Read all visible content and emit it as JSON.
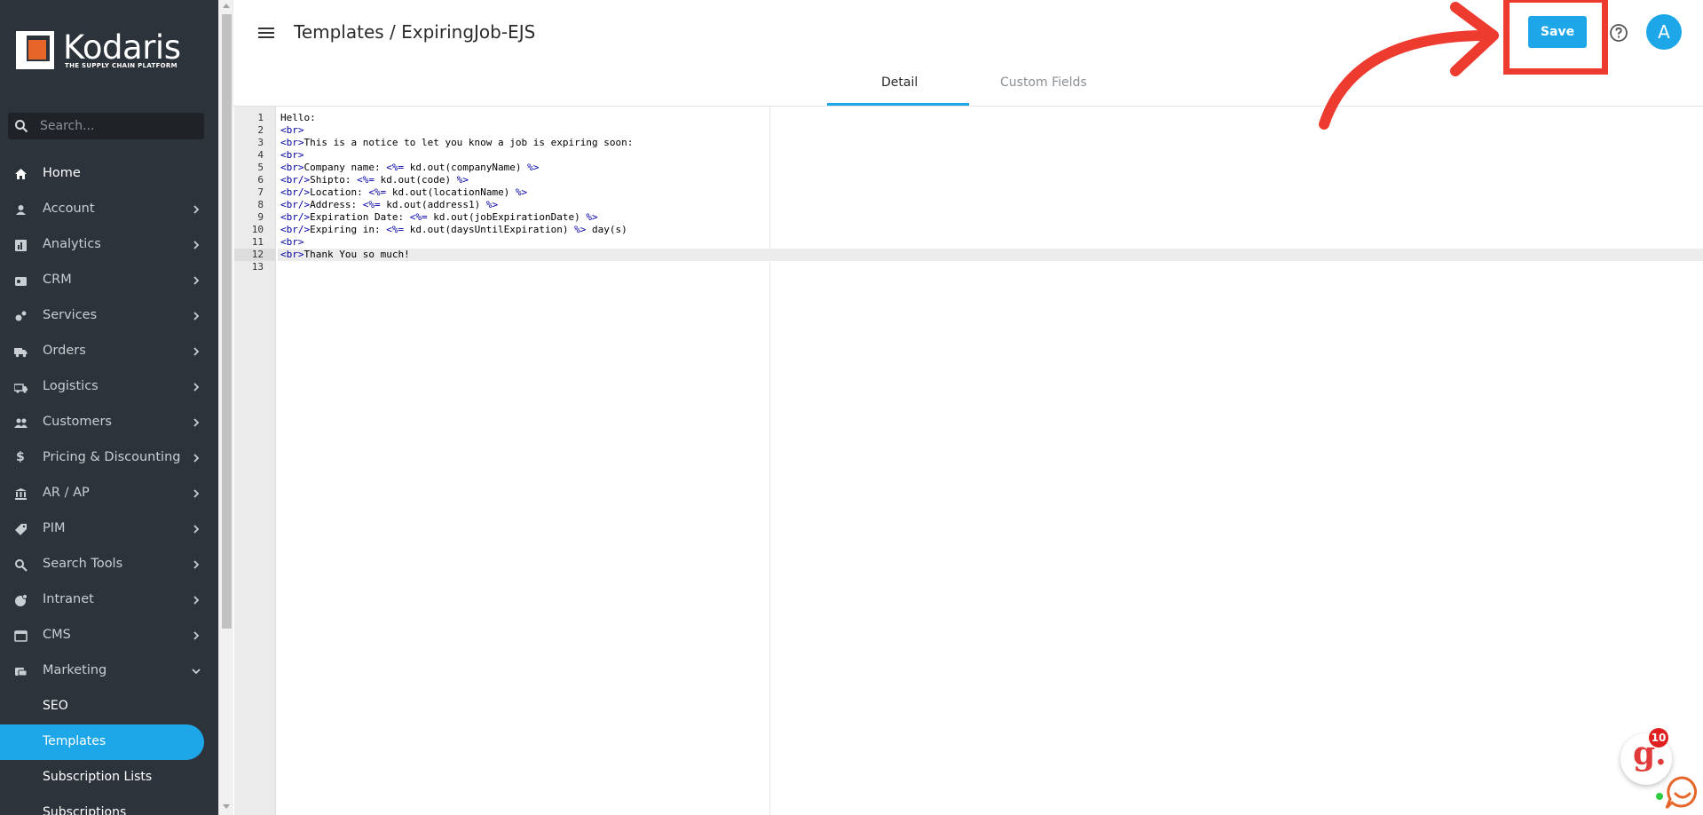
{
  "brand": {
    "name": "Kodaris",
    "tagline": "THE SUPPLY CHAIN PLATFORM",
    "logo_color": "#e8652a"
  },
  "search": {
    "placeholder": "Search..."
  },
  "sidebar": {
    "items": [
      {
        "label": "Home",
        "icon": "home-icon",
        "has_chevron": false
      },
      {
        "label": "Account",
        "icon": "account-icon",
        "has_chevron": true
      },
      {
        "label": "Analytics",
        "icon": "analytics-icon",
        "has_chevron": true
      },
      {
        "label": "CRM",
        "icon": "crm-icon",
        "has_chevron": true
      },
      {
        "label": "Services",
        "icon": "services-icon",
        "has_chevron": true
      },
      {
        "label": "Orders",
        "icon": "truck-icon",
        "has_chevron": true
      },
      {
        "label": "Logistics",
        "icon": "logistics-icon",
        "has_chevron": true
      },
      {
        "label": "Customers",
        "icon": "customers-icon",
        "has_chevron": true
      },
      {
        "label": "Pricing & Discounting",
        "icon": "dollar-icon",
        "has_chevron": true
      },
      {
        "label": "AR / AP",
        "icon": "bank-icon",
        "has_chevron": true
      },
      {
        "label": "PIM",
        "icon": "tag-icon",
        "has_chevron": true
      },
      {
        "label": "Search Tools",
        "icon": "search-tools-icon",
        "has_chevron": true
      },
      {
        "label": "Intranet",
        "icon": "intranet-icon",
        "has_chevron": true
      },
      {
        "label": "CMS",
        "icon": "cms-icon",
        "has_chevron": true
      },
      {
        "label": "Marketing",
        "icon": "marketing-icon",
        "has_chevron": true,
        "expanded": true
      }
    ],
    "sub_items": [
      {
        "label": "SEO",
        "active": false
      },
      {
        "label": "Templates",
        "active": true
      },
      {
        "label": "Subscription Lists",
        "active": false
      },
      {
        "label": "Subscriptions",
        "active": false
      }
    ]
  },
  "header": {
    "title": "Templates / ExpiringJob-EJS",
    "save_label": "Save",
    "avatar_initial": "A",
    "tabs": [
      {
        "label": "Detail",
        "active": true
      },
      {
        "label": "Custom Fields",
        "active": false
      }
    ]
  },
  "editor": {
    "active_line": 12,
    "lines": [
      "Hello:",
      "<br>",
      "<br>This is a notice to let you know a job is expiring soon:",
      "<br>",
      "<br>Company name: <%= kd.out(companyName) %>",
      "<br/>Shipto: <%= kd.out(code) %>",
      "<br/>Location: <%= kd.out(locationName) %>",
      "<br/>Address: <%= kd.out(address1) %>",
      "<br/>Expiration Date: <%= kd.out(jobExpirationDate) %>",
      "<br/>Expiring in: <%= kd.out(daysUntilExpiration) %> day(s)",
      "<br>",
      "<br>Thank You so much!",
      ""
    ]
  },
  "widget": {
    "letter": "g.",
    "badge": "10"
  },
  "colors": {
    "accent": "#1ea7e8",
    "sidebar_bg": "#2d333b",
    "annotation": "#ee3b30"
  }
}
